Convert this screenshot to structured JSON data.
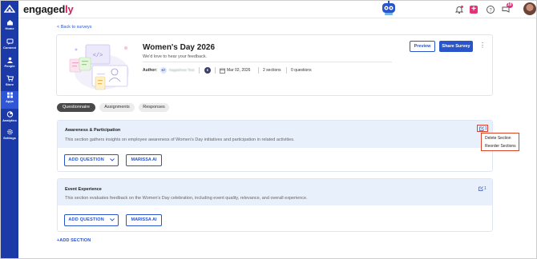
{
  "app": {
    "brand_main": "engaged",
    "brand_accent": "ly",
    "brand_color": "#1c3aa7",
    "accent_color": "#e6317a"
  },
  "sidebar": {
    "items": [
      {
        "label": "Home",
        "icon": "home-icon"
      },
      {
        "label": "Connect",
        "icon": "connect-icon"
      },
      {
        "label": "People",
        "icon": "people-icon"
      },
      {
        "label": "Store",
        "icon": "cart-icon"
      },
      {
        "label": "Apps",
        "icon": "apps-icon",
        "active": true
      },
      {
        "label": "Analytics",
        "icon": "analytics-icon"
      },
      {
        "label": "Settings",
        "icon": "gear-icon"
      }
    ]
  },
  "topbar": {
    "inbox_badge": "10"
  },
  "back_link": "< Back to surveys",
  "survey": {
    "title": "Women's Day 2026",
    "subtitle": "We'd love to hear your feedback.",
    "author_label": "Author:",
    "author_initials": "NT",
    "author_name": "Nagashree Test",
    "second_initial": "E",
    "date": "Mar 02, 2026",
    "sections_count": "2 sections",
    "questions_count": "0 questions",
    "preview_label": "Preview",
    "share_label": "Share Survey",
    "more_label": "⋮"
  },
  "tabs": [
    {
      "label": "Questionnaire",
      "active": true
    },
    {
      "label": "Assignments",
      "active": false
    },
    {
      "label": "Responses",
      "active": false
    }
  ],
  "sections": [
    {
      "title": "Awareness & Participation",
      "description": "This section gathers insights on employee awareness of Women's Day initiatives and participation in related activities.",
      "action_count": "1",
      "add_question_label": "ADD QUESTION",
      "ai_label": "MARISSA AI"
    },
    {
      "title": "Event Experience",
      "description": "This section evaluates feedback on the Women's Day celebration, including event quality, relevance, and overall experience.",
      "action_count": "1",
      "add_question_label": "ADD QUESTION",
      "ai_label": "MARISSA AI"
    }
  ],
  "section_menu": {
    "delete_label": "Delete Section",
    "reorder_label": "Reorder Sections"
  },
  "add_section_label": "+ADD SECTION"
}
